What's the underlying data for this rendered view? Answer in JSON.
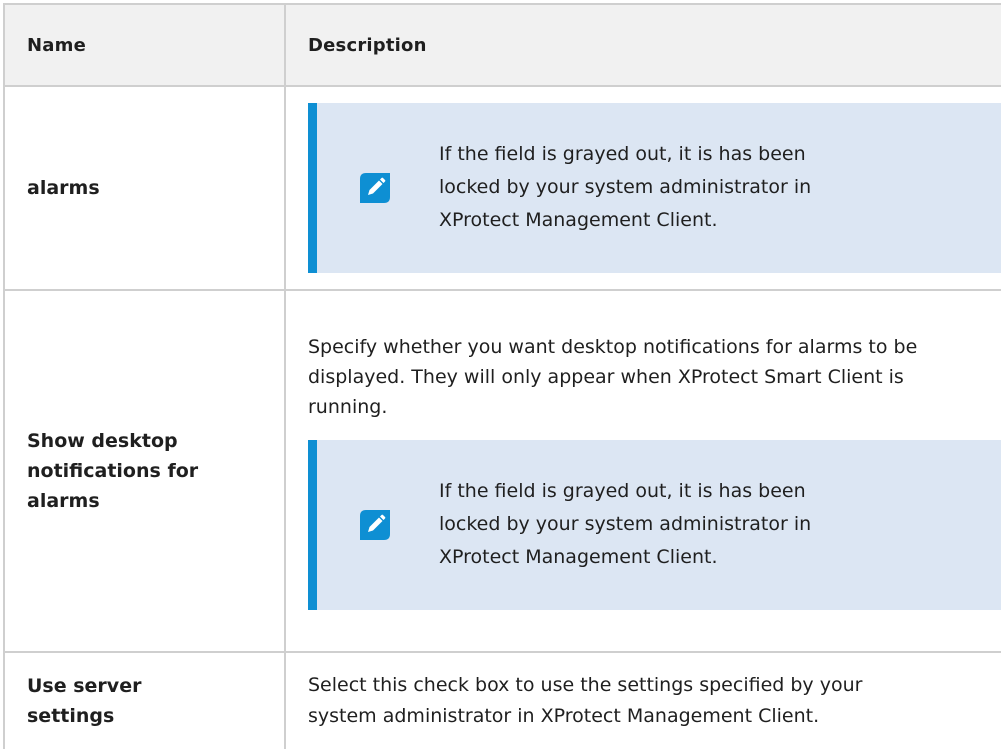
{
  "table": {
    "headers": [
      "Name",
      "Description"
    ],
    "rows": [
      {
        "name": "alarms",
        "note": {
          "icon": "pencil-note-icon",
          "lines": [
            "If the field is grayed out, it is has been",
            "locked by your system administrator in",
            "XProtect Management Client."
          ]
        }
      },
      {
        "name_lines": [
          "Show desktop",
          "notifications for",
          "alarms"
        ],
        "description_lines": [
          "Specify whether you want desktop notifications for alarms to be",
          "displayed. They will only appear when XProtect Smart Client is",
          "running."
        ],
        "note": {
          "icon": "pencil-note-icon",
          "lines": [
            "If the field is grayed out, it is has been",
            "locked by your system administrator in",
            "XProtect Management Client."
          ]
        }
      },
      {
        "name_lines": [
          "Use server",
          "settings"
        ],
        "description_lines": [
          "Select this check box to use the settings specified by your",
          "system administrator in XProtect Management Client."
        ]
      }
    ]
  },
  "colors": {
    "note_background": "#dce6f3",
    "note_accent": "#0e8fd3",
    "header_background": "#f1f1f1",
    "border": "#cfcfcf"
  }
}
